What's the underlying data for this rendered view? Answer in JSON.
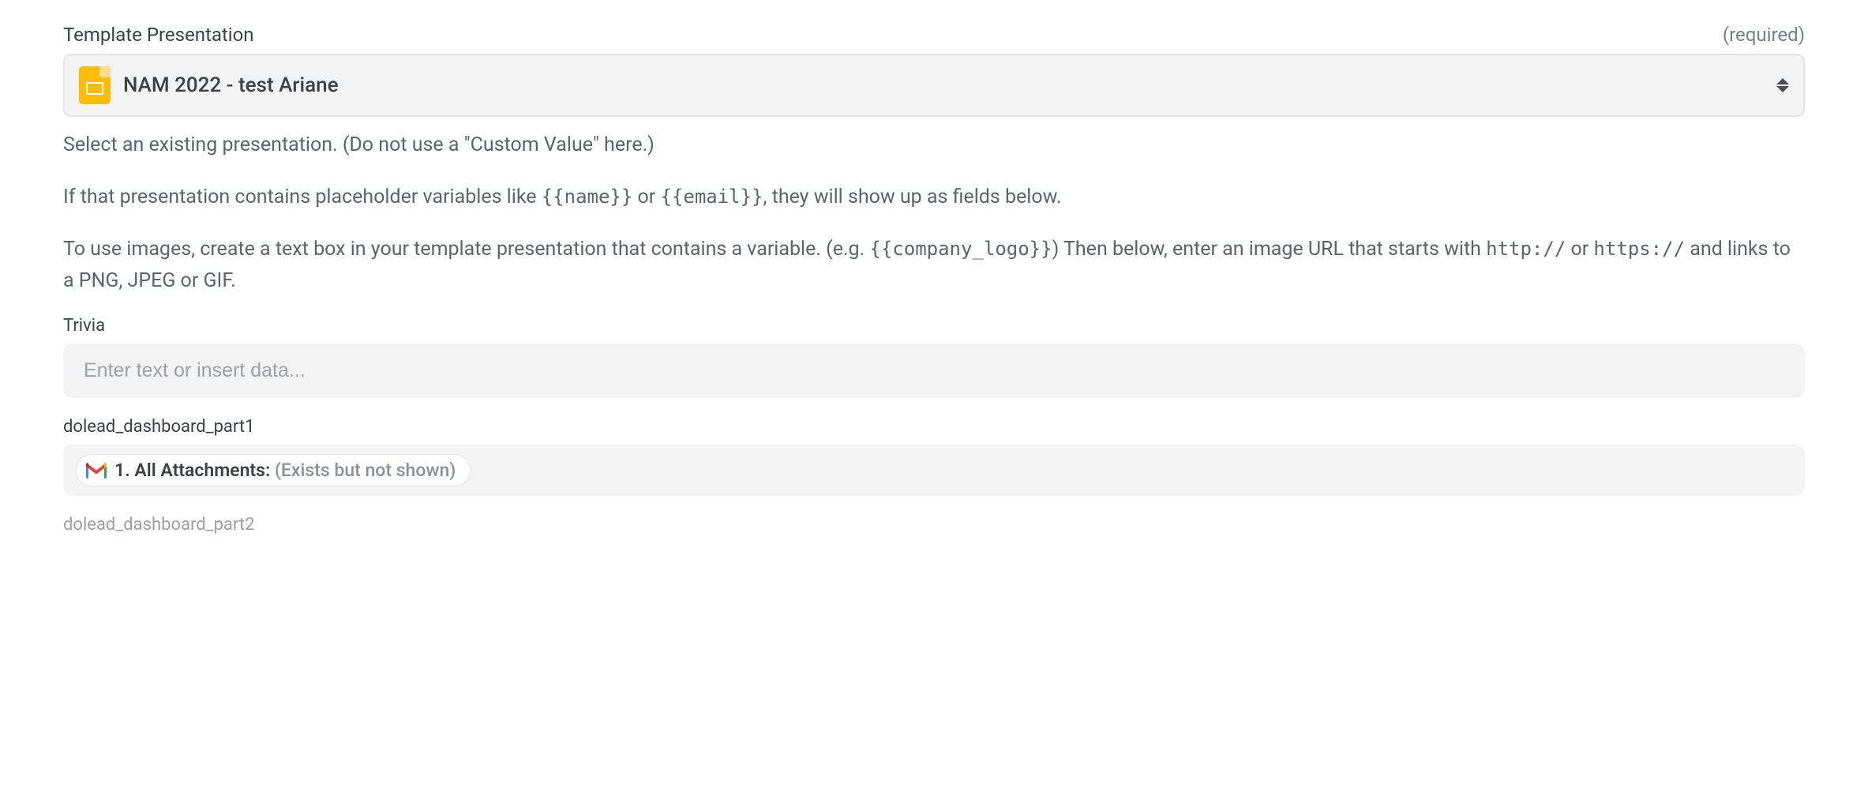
{
  "template_presentation": {
    "label": "Template Presentation",
    "required_text": "(required)",
    "selected_value": "NAM 2022 - test Ariane",
    "help_text_1": "Select an existing presentation. (Do not use a \"Custom Value\" here.)",
    "help_text_2a": "If that presentation contains placeholder variables like ",
    "help_text_2_code1": "{{name}}",
    "help_text_2b": " or ",
    "help_text_2_code2": "{{email}}",
    "help_text_2c": ", they will show up as fields below.",
    "help_text_3a": "To use images, create a text box in your template presentation that contains a variable. (e.g. ",
    "help_text_3_code1": "{{company_logo}}",
    "help_text_3b": ") Then below, enter an image URL that starts with ",
    "help_text_3_code2": "http://",
    "help_text_3c": " or ",
    "help_text_3_code3": "https://",
    "help_text_3d": " and links to a PNG, JPEG or GIF."
  },
  "trivia": {
    "label": "Trivia",
    "placeholder": "Enter text or insert data..."
  },
  "dashboard_part1": {
    "label": "dolead_dashboard_part1",
    "pill_text": "1. All Attachments: ",
    "pill_suffix": "(Exists but not shown)"
  },
  "dashboard_part2": {
    "label": "dolead_dashboard_part2"
  }
}
